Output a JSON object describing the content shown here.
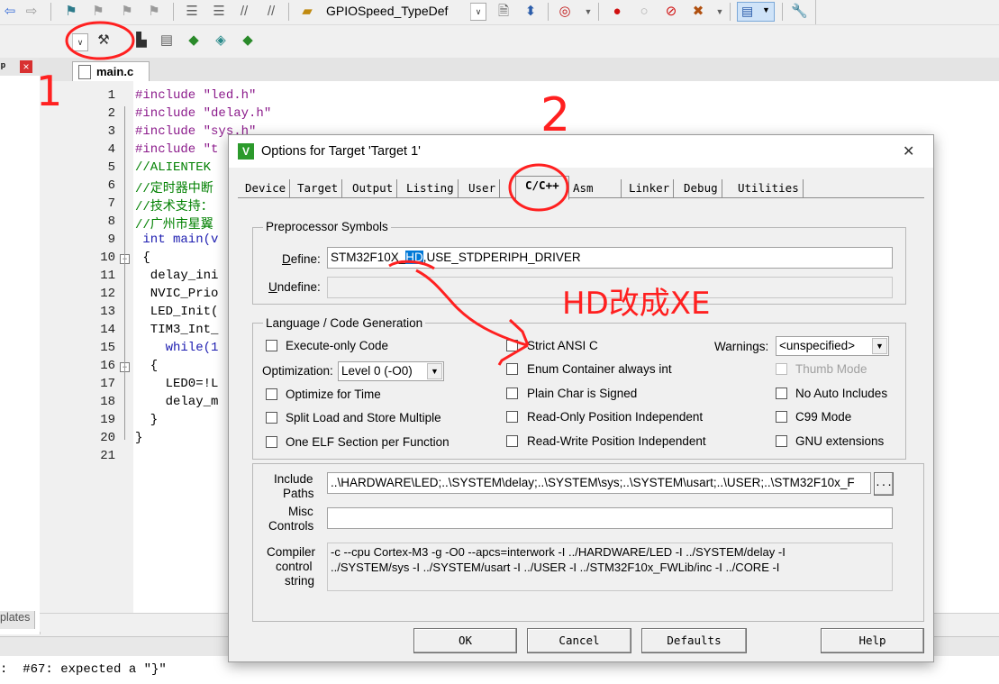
{
  "toolbar": {
    "target_combo": "GPIOSpeed_TypeDef"
  },
  "left_panel": {
    "pin_glyph": "p",
    "close_glyph": "×",
    "bottom_tab": "plates"
  },
  "editor": {
    "file_tab": "main.c",
    "lines": [
      {
        "n": "1",
        "t": "#include \"led.h\""
      },
      {
        "n": "2",
        "t": "#include \"delay.h\""
      },
      {
        "n": "3",
        "t": "#include \"sys.h\""
      },
      {
        "n": "4",
        "t": "#include \"t"
      },
      {
        "n": "5",
        "t": "//ALIENTEK"
      },
      {
        "n": "6",
        "t": "//定时器中断"
      },
      {
        "n": "7",
        "t": "//技术支持："
      },
      {
        "n": "8",
        "t": "//广州市星翼"
      },
      {
        "n": "9",
        "t": " int main(v"
      },
      {
        "n": "10",
        "t": " {"
      },
      {
        "n": "11",
        "t": "  delay_ini"
      },
      {
        "n": "12",
        "t": "  NVIC_Prio"
      },
      {
        "n": "13",
        "t": "  LED_Init("
      },
      {
        "n": "14",
        "t": "  TIM3_Int_"
      },
      {
        "n": "15",
        "t": "    while(1"
      },
      {
        "n": "16",
        "t": "  {"
      },
      {
        "n": "17",
        "t": "    LED0=!L"
      },
      {
        "n": "18",
        "t": "    delay_m"
      },
      {
        "n": "19",
        "t": "  }"
      },
      {
        "n": "20",
        "t": "}"
      },
      {
        "n": "21",
        "t": ""
      }
    ]
  },
  "output": {
    "message": ":  #67: expected a \"}\""
  },
  "dialog": {
    "title": "Options for Target 'Target 1'",
    "close": "✕",
    "tabs": [
      "Device",
      "Target",
      "Output",
      "Listing",
      "User",
      "C/C++",
      "Asm",
      "Linker",
      "Debug",
      "Utilities"
    ],
    "active_tab": "C/C++",
    "preprocessor": {
      "group_title": "Preprocessor Symbols",
      "define_label": "Define:",
      "define_before": "STM32F10X_",
      "define_selected": "HD",
      "define_after": ",USE_STDPERIPH_DRIVER",
      "undefine_label": "Undefine:",
      "undefine_value": ""
    },
    "language": {
      "group_title": "Language / Code Generation",
      "execute_only": "Execute-only Code",
      "optimization_label": "Optimization:",
      "optimization_value": "Level 0 (-O0)",
      "optimize_time": "Optimize for Time",
      "split_load": "Split Load and Store Multiple",
      "one_elf": "One ELF Section per Function",
      "strict_ansi": "Strict ANSI C",
      "enum_container": "Enum Container always int",
      "plain_char": "Plain Char is Signed",
      "ropi": "Read-Only Position Independent",
      "rwpi": "Read-Write Position Independent",
      "warnings_label": "Warnings:",
      "warnings_value": "<unspecified>",
      "thumb_mode": "Thumb Mode",
      "no_auto_includes": "No Auto Includes",
      "c99": "C99 Mode",
      "gnu_ext": "GNU extensions"
    },
    "include": {
      "label_1": "Include",
      "label_2": "Paths",
      "value": "..\\HARDWARE\\LED;..\\SYSTEM\\delay;..\\SYSTEM\\sys;..\\SYSTEM\\usart;..\\USER;..\\STM32F10x_F",
      "browse": "..."
    },
    "misc": {
      "label_1": "Misc",
      "label_2": "Controls",
      "value": ""
    },
    "compiler": {
      "label_1": "Compiler",
      "label_2": "control",
      "label_3": "string",
      "line_1": "-c --cpu Cortex-M3 -g -O0 --apcs=interwork -I ../HARDWARE/LED -I ../SYSTEM/delay -I",
      "line_2": "../SYSTEM/sys -I ../SYSTEM/usart -I ../USER -I ../STM32F10x_FWLib/inc -I ../CORE -I"
    },
    "buttons": {
      "ok": "OK",
      "cancel": "Cancel",
      "defaults": "Defaults",
      "help": "Help"
    }
  },
  "annotations": {
    "one": "1",
    "two": "2",
    "note": "HD改成XE"
  },
  "colors": {
    "annotation": "#ff2020",
    "selection": "#0078d7",
    "comment": "#008000",
    "preprocessor": "#8b1a8b",
    "keyword": "#1c1cb0"
  }
}
